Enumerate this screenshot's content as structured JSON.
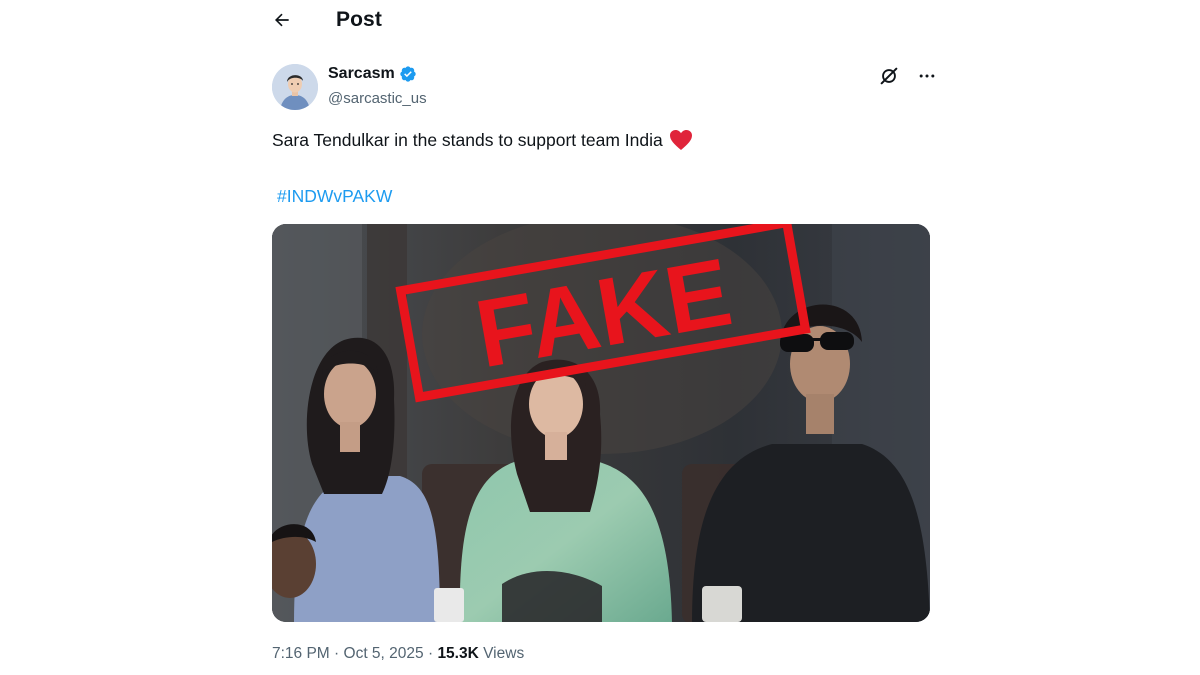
{
  "header": {
    "title": "Post"
  },
  "author": {
    "display_name": "Sarcasm",
    "handle": "@sarcastic_us"
  },
  "tweet": {
    "text": "Sara Tendulkar in the stands to support team India",
    "hashtag": "#INDWvPAKW"
  },
  "media": {
    "stamp_text": "FAKE",
    "stamp_color": "#e8141c"
  },
  "meta": {
    "time": "7:16 PM",
    "separator": " · ",
    "date": "Oct 5, 2025",
    "views_count": "15.3K",
    "views_label": "Views"
  },
  "colors": {
    "accent": "#1d9bf0",
    "text": "#0f1419",
    "muted": "#536471",
    "heart": "#f4212e"
  },
  "icons": [
    "back-arrow-icon",
    "verified-badge-icon",
    "grok-icon",
    "more-icon",
    "heart-emoji-icon"
  ]
}
